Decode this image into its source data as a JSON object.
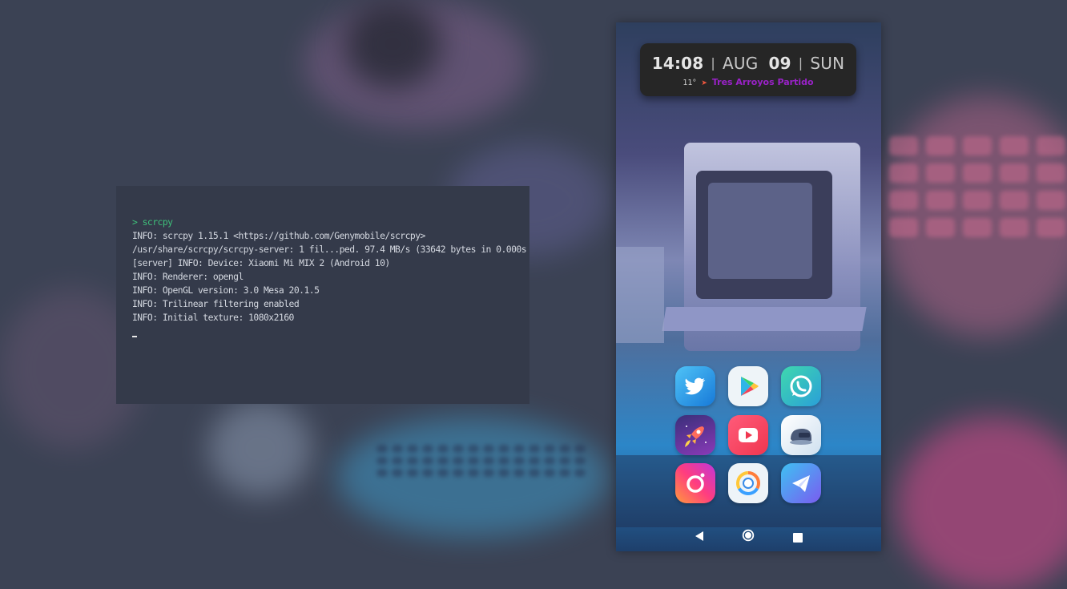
{
  "terminal": {
    "prompt": "> scrcpy",
    "lines": [
      "INFO: scrcpy 1.15.1 <https://github.com/Genymobile/scrcpy>",
      "/usr/share/scrcpy/scrcpy-server: 1 fil...ped. 97.4 MB/s (33642 bytes in 0.000s",
      "[server] INFO: Device: Xiaomi Mi MIX 2 (Android 10)",
      "INFO: Renderer: opengl",
      "INFO: OpenGL version: 3.0 Mesa 20.1.5",
      "INFO: Trilinear filtering enabled",
      "INFO: Initial texture: 1080x2160"
    ]
  },
  "phone": {
    "clock": {
      "time": "14:08",
      "month": "AUG",
      "day": "09",
      "weekday": "SUN",
      "temperature": "11°",
      "location": "Tres Arroyos Partido"
    },
    "apps": [
      {
        "icon": "twitter-icon"
      },
      {
        "icon": "play-store-icon"
      },
      {
        "icon": "whatsapp-icon"
      },
      {
        "icon": "rocket-launcher-icon"
      },
      {
        "icon": "youtube-icon"
      },
      {
        "icon": "helmet-icon"
      },
      {
        "icon": "instagram-icon"
      },
      {
        "icon": "chrome-icon"
      },
      {
        "icon": "telegram-icon"
      }
    ],
    "nav": [
      "back-icon",
      "home-icon",
      "recents-icon"
    ]
  }
}
